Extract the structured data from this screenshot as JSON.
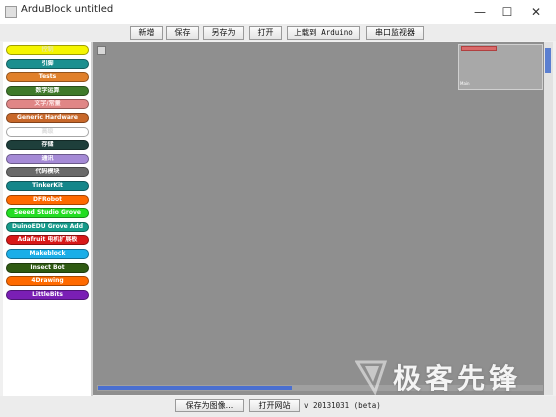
{
  "window": {
    "title": "ArduBlock untitled",
    "controls": {
      "minimize": "—",
      "maximize": "☐",
      "close": "✕"
    }
  },
  "toolbar": {
    "new_label": "新增",
    "save_label": "保存",
    "save_as_label": "另存为",
    "open_label": "打开",
    "upload_label": "上载到 Arduino",
    "serial_monitor_label": "串口监视器"
  },
  "palette": {
    "items": [
      {
        "label": "控制",
        "color": "#f5f500",
        "text_color": "#e6e6a0"
      },
      {
        "label": "引脚",
        "color": "#1b8f8f",
        "text_color": "#ffffff"
      },
      {
        "label": "Tests",
        "color": "#e0802b",
        "text_color": "#ffffff"
      },
      {
        "label": "数学运算",
        "color": "#3f7a2a",
        "text_color": "#ffffff"
      },
      {
        "label": "文字/常量",
        "color": "#e08686",
        "text_color": "#ffe8e8"
      },
      {
        "label": "Generic Hardware",
        "color": "#c8682a",
        "text_color": "#ffffff"
      },
      {
        "label": "高级",
        "color": "#ffffff",
        "text_color": "#dddddd"
      },
      {
        "label": "存储",
        "color": "#1e3f3b",
        "text_color": "#ffffff"
      },
      {
        "label": "通讯",
        "color": "#a58ad6",
        "text_color": "#ffffff"
      },
      {
        "label": "代码模块",
        "color": "#6a6a6a",
        "text_color": "#ffffff"
      },
      {
        "label": "TinkerKit",
        "color": "#14868a",
        "text_color": "#ffffff"
      },
      {
        "label": "DFRobot",
        "color": "#ff6a00",
        "text_color": "#ffffff"
      },
      {
        "label": "Seeed Studio Grove",
        "color": "#22dd22",
        "text_color": "#ffffff"
      },
      {
        "label": "DuinoEDU Grove Add",
        "color": "#159a8a",
        "text_color": "#ffffff"
      },
      {
        "label": "Adafruit 电机扩展板",
        "color": "#d81818",
        "text_color": "#ffffff"
      },
      {
        "label": "Makeblock",
        "color": "#1aaee8",
        "text_color": "#ffffff"
      },
      {
        "label": "Insect Bot",
        "color": "#2f5a12",
        "text_color": "#ffffff"
      },
      {
        "label": "4Drawing",
        "color": "#ff6a00",
        "text_color": "#ffffff"
      },
      {
        "label": "LittleBits",
        "color": "#7a1fb5",
        "text_color": "#ffffff"
      }
    ]
  },
  "minimap": {
    "label": "Main"
  },
  "bottombar": {
    "save_image_label": "保存为图像...",
    "open_website_label": "打开网站",
    "version": "v 20131031 (beta)"
  },
  "watermark": {
    "text": "极客先锋"
  }
}
